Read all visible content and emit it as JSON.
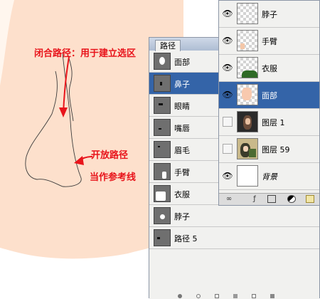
{
  "annotations": {
    "closed_path": "闭合路径：用于建立选区",
    "open_path_line1": "开放路径",
    "open_path_line2": "当作参考线"
  },
  "paths_panel": {
    "tab_label": "路径",
    "items": [
      {
        "label": "面部",
        "selected": false
      },
      {
        "label": "鼻子",
        "selected": true
      },
      {
        "label": "眼睛",
        "selected": false
      },
      {
        "label": "嘴唇",
        "selected": false
      },
      {
        "label": "眉毛",
        "selected": false
      },
      {
        "label": "手臂",
        "selected": false
      },
      {
        "label": "衣服",
        "selected": false
      },
      {
        "label": "脖子",
        "selected": false
      },
      {
        "label": "路径 5",
        "selected": false
      }
    ]
  },
  "layers_panel": {
    "items": [
      {
        "label": "脖子",
        "visible": true,
        "selected": false
      },
      {
        "label": "手臂",
        "visible": true,
        "selected": false
      },
      {
        "label": "衣服",
        "visible": true,
        "selected": false
      },
      {
        "label": "面部",
        "visible": true,
        "selected": true
      },
      {
        "label": "图层 1",
        "visible": false,
        "selected": false
      },
      {
        "label": "图层 59",
        "visible": false,
        "selected": false
      },
      {
        "label": "背景",
        "visible": true,
        "selected": false
      }
    ]
  },
  "colors": {
    "skin": "#fde0cc",
    "selection": "#3464a8",
    "annotation": "#e8141b",
    "panel_bg": "#f1f1ef"
  },
  "icons": {
    "eye": "eye-icon",
    "link": "link-layers-icon",
    "fx": "layer-style-icon",
    "mask": "add-mask-icon",
    "adjust": "adjustment-layer-icon",
    "folder": "new-group-icon",
    "new": "new-layer-icon",
    "trash": "delete-icon"
  }
}
